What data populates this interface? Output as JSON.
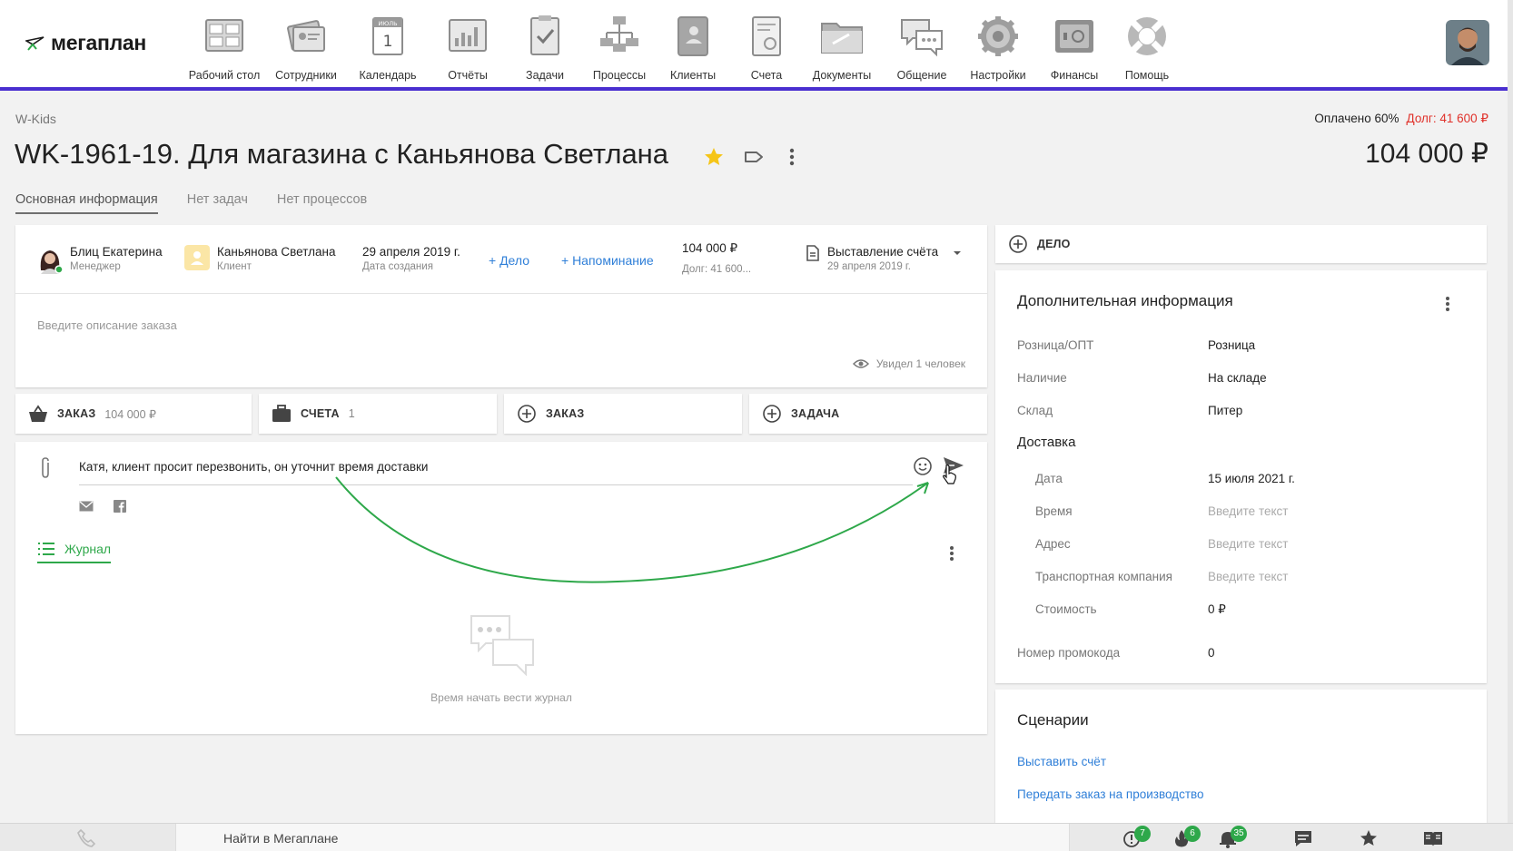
{
  "app": {
    "logo_text": "мегаплан"
  },
  "nav": [
    {
      "label": "Рабочий стол",
      "icon": "desktop-icon"
    },
    {
      "label": "Сотрудники",
      "icon": "employees-icon"
    },
    {
      "label": "Календарь",
      "icon": "calendar-icon",
      "cal_month": "ИЮЛЬ",
      "cal_day": "1"
    },
    {
      "label": "Отчёты",
      "icon": "reports-icon"
    },
    {
      "label": "Задачи",
      "icon": "tasks-icon"
    },
    {
      "label": "Процессы",
      "icon": "processes-icon"
    },
    {
      "label": "Клиенты",
      "icon": "clients-icon"
    },
    {
      "label": "Счета",
      "icon": "invoices-icon"
    },
    {
      "label": "Документы",
      "icon": "documents-icon"
    },
    {
      "label": "Общение",
      "icon": "chat-icon"
    },
    {
      "label": "Настройки",
      "icon": "settings-icon"
    },
    {
      "label": "Финансы",
      "icon": "finance-icon"
    },
    {
      "label": "Помощь",
      "icon": "help-icon"
    }
  ],
  "header": {
    "breadcrumb": "W-Kids",
    "paid": "Оплачено 60%",
    "debt": "Долг: 41 600 ₽",
    "title": "WK-1961-19. Для магазина с Каньянова Светлана",
    "total": "104 000 ₽",
    "tabs": [
      {
        "label": "Основная информация",
        "active": true
      },
      {
        "label": "Нет задач",
        "active": false
      },
      {
        "label": "Нет процессов",
        "active": false
      }
    ]
  },
  "deal": {
    "manager": {
      "name": "Блиц Екатерина",
      "role": "Менеджер"
    },
    "client": {
      "name": "Каньянова Светлана",
      "role": "Клиент"
    },
    "created": {
      "date": "29 апреля 2019 г.",
      "label": "Дата создания"
    },
    "add_task": "+ Дело",
    "add_reminder": "+ Напоминание",
    "amount": {
      "value": "104 000 ₽",
      "debt": "Долг: 41 600..."
    },
    "stage": {
      "name": "Выставление счёта",
      "date": "29 апреля 2019 г."
    },
    "description_placeholder": "Введите описание заказа",
    "seen": "Увидел 1 человек"
  },
  "tiles": [
    {
      "label": "ЗАКАЗ",
      "value": "104 000 ₽",
      "icon": "basket-icon"
    },
    {
      "label": "СЧЕТА",
      "value": "1",
      "icon": "briefcase-icon"
    },
    {
      "label": "ЗАКАЗ",
      "value": "",
      "icon": "plus-circle-icon"
    },
    {
      "label": "ЗАДАЧА",
      "value": "",
      "icon": "plus-circle-icon"
    }
  ],
  "comment": {
    "text": "Катя, клиент просит перезвонить, он уточнит время доставки",
    "journal_tab": "Журнал",
    "empty_text": "Время начать вести журнал"
  },
  "side": {
    "delo_label": "ДЕЛО",
    "info_title": "Дополнительная информация",
    "fields": [
      {
        "key": "Розница/ОПТ",
        "value": "Розница"
      },
      {
        "key": "Наличие",
        "value": "На складе"
      },
      {
        "key": "Склад",
        "value": "Питер"
      }
    ],
    "delivery_title": "Доставка",
    "delivery": [
      {
        "key": "Дата",
        "value": "15 июля 2021 г.",
        "placeholder": false
      },
      {
        "key": "Время",
        "value": "Введите текст",
        "placeholder": true
      },
      {
        "key": "Адрес",
        "value": "Введите текст",
        "placeholder": true
      },
      {
        "key": "Транспортная компания",
        "value": "Введите текст",
        "placeholder": true
      },
      {
        "key": "Стоимость",
        "value": "0 ₽",
        "placeholder": false
      }
    ],
    "promo": {
      "key": "Номер промокода",
      "value": "0"
    },
    "scenarios_title": "Сценарии",
    "scenarios": [
      "Выставить счёт",
      "Передать заказ на производство"
    ]
  },
  "bottom": {
    "search_placeholder": "Найти в Мегаплане",
    "badges": {
      "alerts": "7",
      "hot": "6",
      "notifications": "35"
    }
  },
  "colors": {
    "accent": "#4a2fd0",
    "link": "#2f7fd8",
    "success": "#2ea84a",
    "debt": "#e0312a",
    "star": "#f5c518"
  }
}
